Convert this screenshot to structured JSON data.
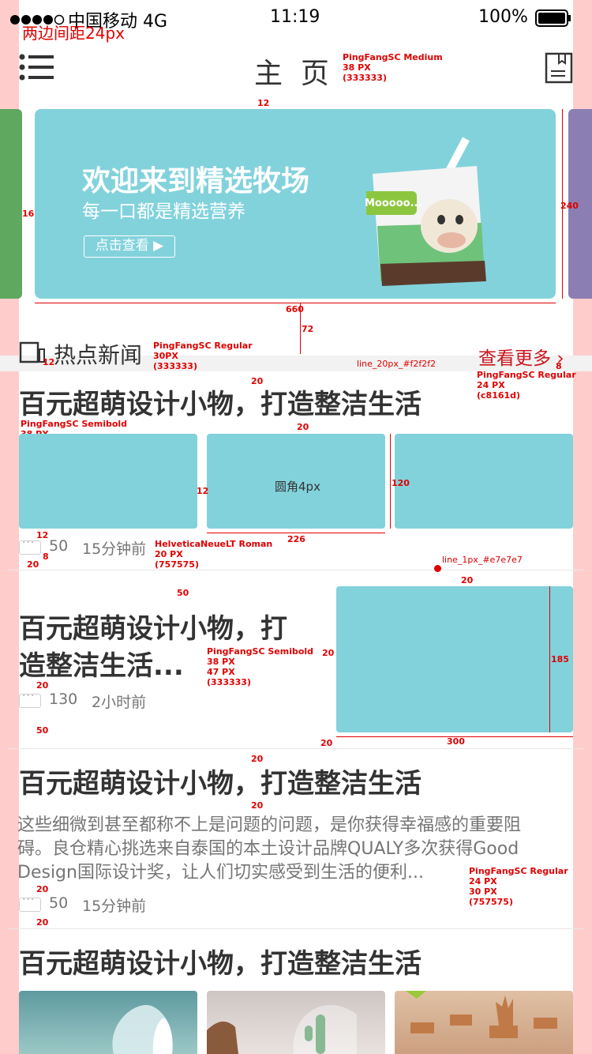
{
  "status_bar": {
    "carrier": "中国移动 4G",
    "time": "11:19",
    "battery": "100%"
  },
  "guides": {
    "margin_note": "两边间距24px"
  },
  "header": {
    "title": "主  页"
  },
  "banner": {
    "headline": "欢迎来到精选牧场",
    "subline": "每一口都是精选营养",
    "cta": "点击查看 ▶",
    "bubble": "Mooooo...",
    "colors": {
      "bg": "#82d2dc",
      "left_peek": "#5fa860",
      "right_peek": "#8a7eb2"
    }
  },
  "hot_news": {
    "title": "热点新闻",
    "more": "查看更多"
  },
  "articles": [
    {
      "title": "百元超萌设计小物，打造整洁生活",
      "comments": "50",
      "time": "15分钟前",
      "image_caption": "圆角4px"
    },
    {
      "title_line1": "百元超萌设计小物，打",
      "title_line2": "造整洁生活...",
      "comments": "130",
      "time": "2小时前"
    },
    {
      "title": "百元超萌设计小物，打造整洁生活",
      "excerpt_line1": "这些细微到甚至都称不上是问题的问题，是你获得幸福感的重要阻",
      "excerpt_line2": "碍。良仓精心挑选来自泰国的本土设计品牌QUALY多次获得Good",
      "excerpt_line3": "Design国际设计奖，让人们切实感受到生活的便利...",
      "comments": "50",
      "time": "15分钟前"
    },
    {
      "title": "百元超萌设计小物，打造整洁生活"
    }
  ],
  "annotations": {
    "title_font": "PingFangSC Medium\n38 PX\n(333333)",
    "hot_font": "PingFangSC Regular\n30PX\n(333333)",
    "more_font": "PingFangSC Regular\n24 PX\n(c8161d)",
    "news_font": "PingFangSC Semibold\n38 PX\n(333333)",
    "meta_font": "HelveticaNeueLT Roman\n20 PX\n(757575)",
    "news2_font": "PingFangSC Semibold\n38 PX\n47 PX\n(333333)",
    "excerpt_font": "PingFangSC Regular\n24 PX\n30 PX\n(757575)",
    "line20": "line_20px_#f2f2f2",
    "line1": "line_1px_#e7e7e7",
    "d12": "12",
    "d16": "16",
    "d240": "240",
    "d660": "660",
    "d72": "72",
    "d20": "20",
    "d8": "8",
    "d120": "120",
    "d226": "226",
    "d50": "50",
    "d185": "185",
    "d300": "300"
  }
}
